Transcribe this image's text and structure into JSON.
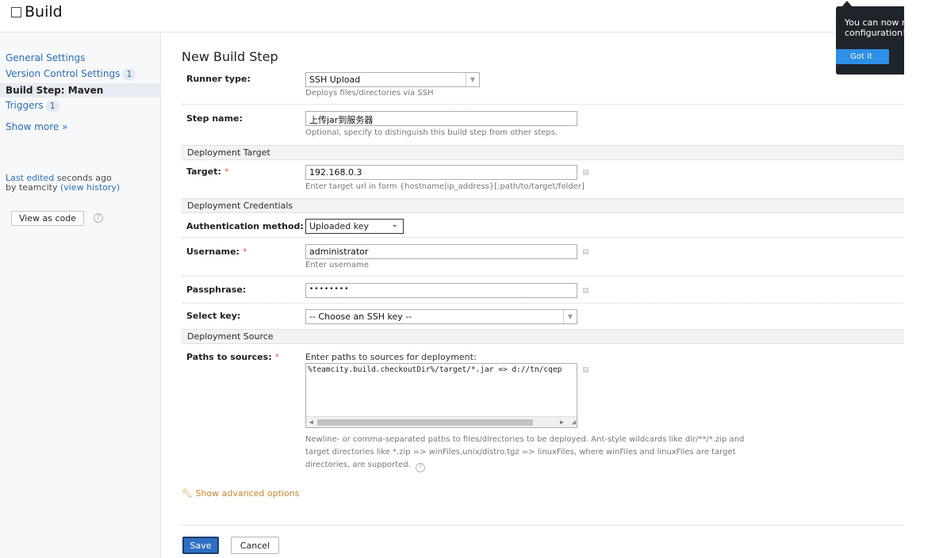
{
  "page": {
    "title": "Build"
  },
  "sidebar": {
    "general_settings": "General Settings",
    "vcs_settings": "Version Control Settings",
    "vcs_count": "1",
    "build_step": "Build Step: Maven",
    "triggers": "Triggers",
    "triggers_count": "1",
    "show_more": "Show more »",
    "last_edited": "Last edited",
    "last_edited_time": "seconds ago",
    "by_text": "by teamcity",
    "view_history": "(view history)",
    "view_as_code": "View as code"
  },
  "form": {
    "title": "New Build Step",
    "runner_type_label": "Runner type:",
    "runner_type_value": "SSH Upload",
    "runner_type_note": "Deploys files/directories via SSH",
    "step_name_label": "Step name:",
    "step_name_value": "上传jar到服务器",
    "step_name_note": "Optional, specify to distinguish this build step from other steps.",
    "section_target": "Deployment Target",
    "target_label": "Target:",
    "target_value": "192.168.0.3",
    "target_note": "Enter target url in form {hostname|ip_address}[:path/to/target/folder]",
    "section_credentials": "Deployment Credentials",
    "auth_label": "Authentication method:",
    "auth_value": "Uploaded key",
    "username_label": "Username:",
    "username_value": "administrator",
    "username_note": "Enter username",
    "passphrase_label": "Passphrase:",
    "passphrase_value": "••••••••",
    "select_key_label": "Select key:",
    "select_key_value": "-- Choose an SSH key --",
    "section_source": "Deployment Source",
    "paths_label": "Paths to sources:",
    "paths_intro": "Enter paths to sources for deployment:",
    "paths_value": "%teamcity.build.checkoutDir%/target/*.jar => d://tn/cqep",
    "paths_desc": "Newline- or comma-separated paths to files/directories to be deployed. Ant-style wildcards like dir/**/*.zip and target directories like *.zip => winFiles,unix/distro.tgz => linuxFiles, where winFiles and linuxFiles are target directories, are supported.",
    "advanced": "Show advanced options",
    "required_mark": "*"
  },
  "buttons": {
    "save": "Save",
    "cancel": "Cancel"
  },
  "popup": {
    "line1": "You can now r",
    "line2": "configuration!",
    "button": "Got it"
  },
  "colors": {
    "link": "#2d6db5",
    "accent": "#2f6fc1",
    "required": "#e05a4a",
    "popup_bg": "#1f242b"
  }
}
